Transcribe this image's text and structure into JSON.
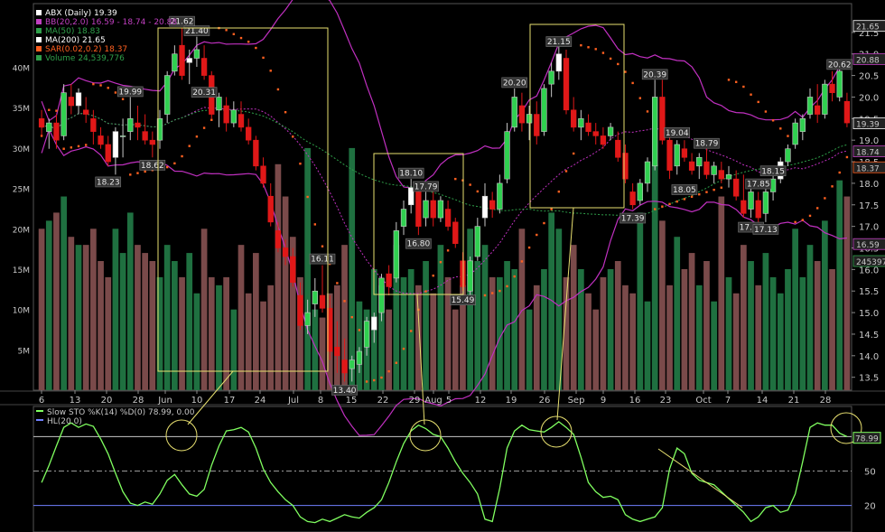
{
  "chart_data": {
    "type": "candlestick",
    "price_panel": {
      "legend": [
        {
          "text": "ABX (Daily) 19.39",
          "color": "#ffffff",
          "icon": "candle-icon"
        },
        {
          "text": "BB(20,2.0) 16.59 - 18.74 - 20.88",
          "color": "#c040c0",
          "icon": "line-icon"
        },
        {
          "text": "MA(50) 18.83",
          "color": "#2fa04a",
          "icon": "dotted-line-icon"
        },
        {
          "text": "MA(200) 21.65",
          "color": "#ffffff",
          "icon": "dotted-line-icon"
        },
        {
          "text": "SAR(0.02,0.2) 18.37",
          "color": "#ff6020",
          "icon": "dots-icon"
        },
        {
          "text": "Volume 24,539,776",
          "color": "#2fa04a",
          "icon": "bars-icon"
        }
      ],
      "y_ticks": [
        "21.5",
        "21.0",
        "20.5",
        "20.0",
        "19.5",
        "19.0",
        "18.5",
        "18.0",
        "17.5",
        "17.0",
        "16.5",
        "16.0",
        "15.5",
        "15.0",
        "14.5",
        "14.0",
        "13.5"
      ],
      "ylim": [
        13.2,
        22.0
      ],
      "volume_ticks": [
        "40M",
        "35M",
        "30M",
        "25M",
        "20M",
        "15M",
        "10M",
        "5M"
      ],
      "volume_max_m": 47,
      "price_labels": [
        "21.62",
        "21.40",
        "20.31",
        "19.99",
        "18.62",
        "18.23",
        "16.11",
        "13.40",
        "18.10",
        "17.79",
        "16.80",
        "15.49",
        "20.20",
        "21.15",
        "17.39",
        "20.39",
        "19.04",
        "18.79",
        "18.05",
        "17.85",
        "18.15",
        "17.18",
        "17.13",
        "20.62"
      ],
      "right_labels": [
        {
          "text": "21.65",
          "color": "#ffffff"
        },
        {
          "text": "20.88",
          "color": "#c040c0"
        },
        {
          "text": "19.39",
          "color": "#ffffff"
        },
        {
          "text": "18.74",
          "color": "#c040c0"
        },
        {
          "text": "18.37",
          "color": "#ff6020"
        },
        {
          "text": "16.59",
          "color": "#c040c0"
        },
        {
          "text": "24539776",
          "color": "#2fa04a"
        }
      ],
      "candles": [
        {
          "o": 19.5,
          "h": 19.7,
          "l": 19.1,
          "c": 19.3
        },
        {
          "o": 19.2,
          "h": 19.5,
          "l": 18.8,
          "c": 19.4
        },
        {
          "o": 19.4,
          "h": 19.6,
          "l": 18.8,
          "c": 19.0
        },
        {
          "o": 19.1,
          "h": 20.3,
          "l": 19.0,
          "c": 20.1
        },
        {
          "o": 20.0,
          "h": 20.3,
          "l": 19.6,
          "c": 19.8
        },
        {
          "o": 19.8,
          "h": 20.2,
          "l": 19.6,
          "c": 20.1
        },
        {
          "o": 19.7,
          "h": 20.0,
          "l": 19.4,
          "c": 19.6
        },
        {
          "o": 19.5,
          "h": 19.7,
          "l": 18.9,
          "c": 19.2
        },
        {
          "o": 19.1,
          "h": 19.3,
          "l": 18.8,
          "c": 18.9
        },
        {
          "o": 18.9,
          "h": 19.1,
          "l": 18.4,
          "c": 18.5
        },
        {
          "o": 18.6,
          "h": 19.3,
          "l": 18.2,
          "c": 19.2
        },
        {
          "o": 19.1,
          "h": 19.5,
          "l": 18.6,
          "c": 19.1
        },
        {
          "o": 19.2,
          "h": 20.0,
          "l": 19.0,
          "c": 19.5
        },
        {
          "o": 19.4,
          "h": 19.8,
          "l": 19.0,
          "c": 19.3
        },
        {
          "o": 19.2,
          "h": 19.6,
          "l": 18.9,
          "c": 19.0
        },
        {
          "o": 19.0,
          "h": 19.2,
          "l": 18.6,
          "c": 18.9
        },
        {
          "o": 19.0,
          "h": 19.7,
          "l": 18.8,
          "c": 19.5
        },
        {
          "o": 19.6,
          "h": 20.6,
          "l": 19.4,
          "c": 20.5
        },
        {
          "o": 20.6,
          "h": 21.2,
          "l": 20.5,
          "c": 21.0
        },
        {
          "o": 21.2,
          "h": 21.6,
          "l": 20.4,
          "c": 20.5
        },
        {
          "o": 20.8,
          "h": 21.1,
          "l": 20.3,
          "c": 20.9
        },
        {
          "o": 20.9,
          "h": 21.4,
          "l": 20.7,
          "c": 21.1
        },
        {
          "o": 20.9,
          "h": 21.2,
          "l": 20.4,
          "c": 20.5
        },
        {
          "o": 20.5,
          "h": 20.6,
          "l": 19.5,
          "c": 19.6
        },
        {
          "o": 19.7,
          "h": 20.1,
          "l": 19.3,
          "c": 20.0
        },
        {
          "o": 19.8,
          "h": 20.0,
          "l": 19.2,
          "c": 19.4
        },
        {
          "o": 19.4,
          "h": 19.9,
          "l": 19.3,
          "c": 19.7
        },
        {
          "o": 19.6,
          "h": 19.9,
          "l": 19.2,
          "c": 19.3
        },
        {
          "o": 19.3,
          "h": 19.5,
          "l": 18.9,
          "c": 19.0
        },
        {
          "o": 19.0,
          "h": 19.1,
          "l": 18.3,
          "c": 18.4
        },
        {
          "o": 18.4,
          "h": 18.6,
          "l": 17.9,
          "c": 18.0
        },
        {
          "o": 17.7,
          "h": 18.0,
          "l": 17.0,
          "c": 17.1
        },
        {
          "o": 16.9,
          "h": 17.1,
          "l": 16.4,
          "c": 16.5
        },
        {
          "o": 16.5,
          "h": 16.7,
          "l": 16.1,
          "c": 16.3
        },
        {
          "o": 16.3,
          "h": 16.5,
          "l": 15.6,
          "c": 15.7
        },
        {
          "o": 15.4,
          "h": 15.7,
          "l": 14.6,
          "c": 14.7
        },
        {
          "o": 14.7,
          "h": 15.3,
          "l": 14.5,
          "c": 15.0
        },
        {
          "o": 15.2,
          "h": 15.8,
          "l": 14.9,
          "c": 15.5
        },
        {
          "o": 15.4,
          "h": 16.1,
          "l": 15.0,
          "c": 15.1
        },
        {
          "o": 15.1,
          "h": 15.4,
          "l": 13.9,
          "c": 14.1
        },
        {
          "o": 14.2,
          "h": 14.8,
          "l": 13.6,
          "c": 14.0
        },
        {
          "o": 13.9,
          "h": 14.4,
          "l": 13.4,
          "c": 13.6
        },
        {
          "o": 13.7,
          "h": 14.0,
          "l": 13.4,
          "c": 13.9
        },
        {
          "o": 13.8,
          "h": 14.2,
          "l": 13.6,
          "c": 14.1
        },
        {
          "o": 14.2,
          "h": 14.9,
          "l": 14.0,
          "c": 14.8
        },
        {
          "o": 14.6,
          "h": 15.0,
          "l": 14.3,
          "c": 14.9
        },
        {
          "o": 15.0,
          "h": 15.9,
          "l": 14.8,
          "c": 15.8
        },
        {
          "o": 15.9,
          "h": 16.1,
          "l": 15.4,
          "c": 15.6
        },
        {
          "o": 15.8,
          "h": 17.1,
          "l": 15.7,
          "c": 16.9
        },
        {
          "o": 17.0,
          "h": 17.6,
          "l": 16.8,
          "c": 17.4
        },
        {
          "o": 17.5,
          "h": 18.1,
          "l": 17.3,
          "c": 17.9
        },
        {
          "o": 17.8,
          "h": 18.0,
          "l": 16.8,
          "c": 17.0
        },
        {
          "o": 17.2,
          "h": 17.8,
          "l": 17.0,
          "c": 17.6
        },
        {
          "o": 17.6,
          "h": 17.8,
          "l": 17.0,
          "c": 17.2
        },
        {
          "o": 17.2,
          "h": 17.7,
          "l": 17.1,
          "c": 17.6
        },
        {
          "o": 17.4,
          "h": 17.6,
          "l": 16.9,
          "c": 17.0
        },
        {
          "o": 17.1,
          "h": 17.2,
          "l": 16.5,
          "c": 16.6
        },
        {
          "o": 16.2,
          "h": 16.4,
          "l": 15.5,
          "c": 15.6
        },
        {
          "o": 15.5,
          "h": 16.3,
          "l": 15.4,
          "c": 16.2
        },
        {
          "o": 16.3,
          "h": 17.2,
          "l": 16.2,
          "c": 17.0
        },
        {
          "o": 17.2,
          "h": 18.0,
          "l": 17.0,
          "c": 17.7
        },
        {
          "o": 17.6,
          "h": 17.8,
          "l": 17.2,
          "c": 17.4
        },
        {
          "o": 17.4,
          "h": 18.2,
          "l": 17.3,
          "c": 18.0
        },
        {
          "o": 18.1,
          "h": 19.4,
          "l": 18.0,
          "c": 19.2
        },
        {
          "o": 19.3,
          "h": 20.2,
          "l": 19.2,
          "c": 20.0
        },
        {
          "o": 19.8,
          "h": 20.1,
          "l": 19.2,
          "c": 19.4
        },
        {
          "o": 19.4,
          "h": 19.8,
          "l": 19.0,
          "c": 19.6
        },
        {
          "o": 19.6,
          "h": 19.9,
          "l": 18.9,
          "c": 19.1
        },
        {
          "o": 19.2,
          "h": 20.3,
          "l": 19.1,
          "c": 20.2
        },
        {
          "o": 20.3,
          "h": 20.8,
          "l": 20.0,
          "c": 20.6
        },
        {
          "o": 20.6,
          "h": 21.2,
          "l": 20.4,
          "c": 21.0
        },
        {
          "o": 20.9,
          "h": 21.1,
          "l": 19.6,
          "c": 19.7
        },
        {
          "o": 19.7,
          "h": 20.0,
          "l": 19.2,
          "c": 19.3
        },
        {
          "o": 19.3,
          "h": 19.7,
          "l": 19.0,
          "c": 19.5
        },
        {
          "o": 19.4,
          "h": 19.6,
          "l": 19.1,
          "c": 19.2
        },
        {
          "o": 19.2,
          "h": 19.4,
          "l": 18.9,
          "c": 19.1
        },
        {
          "o": 19.1,
          "h": 19.3,
          "l": 18.8,
          "c": 18.9
        },
        {
          "o": 19.1,
          "h": 19.4,
          "l": 19.0,
          "c": 19.3
        },
        {
          "o": 19.0,
          "h": 19.2,
          "l": 18.5,
          "c": 18.6
        },
        {
          "o": 18.7,
          "h": 18.9,
          "l": 18.0,
          "c": 18.1
        },
        {
          "o": 17.8,
          "h": 18.0,
          "l": 17.4,
          "c": 17.5
        },
        {
          "o": 17.6,
          "h": 18.1,
          "l": 17.5,
          "c": 18.0
        },
        {
          "o": 18.0,
          "h": 18.6,
          "l": 17.8,
          "c": 18.5
        },
        {
          "o": 18.4,
          "h": 20.4,
          "l": 18.3,
          "c": 20.0
        },
        {
          "o": 20.0,
          "h": 20.4,
          "l": 18.9,
          "c": 19.0
        },
        {
          "o": 19.0,
          "h": 19.2,
          "l": 18.1,
          "c": 18.3
        },
        {
          "o": 18.4,
          "h": 19.0,
          "l": 18.2,
          "c": 18.9
        },
        {
          "o": 18.8,
          "h": 19.0,
          "l": 18.5,
          "c": 18.6
        },
        {
          "o": 18.5,
          "h": 18.7,
          "l": 18.2,
          "c": 18.3
        },
        {
          "o": 18.4,
          "h": 18.7,
          "l": 18.1,
          "c": 18.6
        },
        {
          "o": 18.5,
          "h": 18.8,
          "l": 18.1,
          "c": 18.2
        },
        {
          "o": 18.2,
          "h": 18.5,
          "l": 18.0,
          "c": 18.4
        },
        {
          "o": 18.3,
          "h": 18.5,
          "l": 18.0,
          "c": 18.1
        },
        {
          "o": 18.1,
          "h": 18.4,
          "l": 17.9,
          "c": 18.2
        },
        {
          "o": 18.1,
          "h": 18.3,
          "l": 17.6,
          "c": 17.7
        },
        {
          "o": 17.6,
          "h": 18.2,
          "l": 17.2,
          "c": 17.3
        },
        {
          "o": 17.4,
          "h": 17.9,
          "l": 17.2,
          "c": 17.8
        },
        {
          "o": 17.6,
          "h": 17.8,
          "l": 17.1,
          "c": 17.2
        },
        {
          "o": 17.3,
          "h": 17.9,
          "l": 17.1,
          "c": 17.8
        },
        {
          "o": 17.8,
          "h": 18.2,
          "l": 17.6,
          "c": 18.1
        },
        {
          "o": 18.1,
          "h": 18.6,
          "l": 18.0,
          "c": 18.5
        },
        {
          "o": 18.5,
          "h": 18.9,
          "l": 18.4,
          "c": 18.8
        },
        {
          "o": 18.9,
          "h": 19.5,
          "l": 18.8,
          "c": 19.4
        },
        {
          "o": 19.2,
          "h": 19.6,
          "l": 19.0,
          "c": 19.5
        },
        {
          "o": 19.6,
          "h": 20.2,
          "l": 19.5,
          "c": 20.0
        },
        {
          "o": 19.8,
          "h": 20.3,
          "l": 19.4,
          "c": 19.6
        },
        {
          "o": 19.6,
          "h": 20.4,
          "l": 19.5,
          "c": 20.3
        },
        {
          "o": 20.3,
          "h": 20.6,
          "l": 19.9,
          "c": 20.1
        },
        {
          "o": 20.0,
          "h": 20.8,
          "l": 19.9,
          "c": 20.6
        },
        {
          "o": 19.9,
          "h": 20.1,
          "l": 19.3,
          "c": 19.4
        }
      ],
      "volume_m": [
        20,
        21,
        22,
        24,
        19,
        18,
        18,
        20,
        16,
        14,
        20,
        17,
        22,
        18,
        17,
        16,
        14,
        18,
        16,
        14,
        17,
        12,
        20,
        14,
        13,
        14,
        10,
        18,
        12,
        17,
        11,
        13,
        28,
        24,
        19,
        14,
        30,
        10,
        9,
        12,
        13,
        18,
        30,
        11,
        10,
        15,
        13,
        10,
        18,
        14,
        15,
        13,
        16,
        12,
        18,
        14,
        10,
        13,
        20,
        16,
        18,
        14,
        14,
        16,
        15,
        20,
        10,
        13,
        15,
        22,
        20,
        14,
        18,
        15,
        12,
        10,
        14,
        15,
        16,
        13,
        12,
        22,
        11,
        28,
        21,
        13,
        19,
        15,
        17,
        13,
        16,
        11,
        24,
        14,
        12,
        18,
        16,
        13,
        17,
        14,
        12,
        15,
        20,
        14,
        18,
        16,
        21,
        15,
        26,
        24
      ]
    },
    "x_ticks": [
      "6",
      "13",
      "20",
      "28",
      "Jun",
      "10",
      "17",
      "24",
      "Jul",
      "8",
      "15",
      "22",
      "29",
      "Aug",
      "5",
      "12",
      "19",
      "26",
      "Sep",
      "9",
      "16",
      "23",
      "Oct",
      "7",
      "14",
      "21",
      "28"
    ],
    "oscillator": {
      "legend": [
        {
          "text": "Slow STO %K(14) %D(0) 78.99, 0.00",
          "color": "#80ff60",
          "icon": "line-icon"
        },
        {
          "text": "HL(20.0)",
          "color": "#7080ff",
          "icon": "line-icon"
        }
      ],
      "y_ticks": [
        "50",
        "20"
      ],
      "value_label": "78.99",
      "ylim": [
        0,
        100
      ],
      "k_values": [
        40,
        55,
        72,
        88,
        92,
        88,
        91,
        89,
        78,
        65,
        48,
        32,
        22,
        20,
        23,
        21,
        30,
        42,
        47,
        38,
        30,
        28,
        34,
        55,
        72,
        85,
        86,
        88,
        84,
        70,
        52,
        40,
        32,
        25,
        20,
        10,
        6,
        5,
        8,
        6,
        9,
        12,
        10,
        9,
        14,
        18,
        25,
        40,
        58,
        74,
        85,
        90,
        87,
        82,
        80,
        70,
        58,
        48,
        40,
        30,
        8,
        6,
        35,
        70,
        85,
        90,
        86,
        85,
        84,
        88,
        93,
        88,
        82,
        62,
        40,
        32,
        27,
        28,
        25,
        12,
        8,
        6,
        8,
        10,
        18,
        52,
        70,
        65,
        48,
        42,
        40,
        38,
        32,
        26,
        20,
        14,
        6,
        10,
        18,
        20,
        14,
        16,
        30,
        58,
        88,
        92,
        90,
        90,
        83,
        80
      ]
    }
  }
}
